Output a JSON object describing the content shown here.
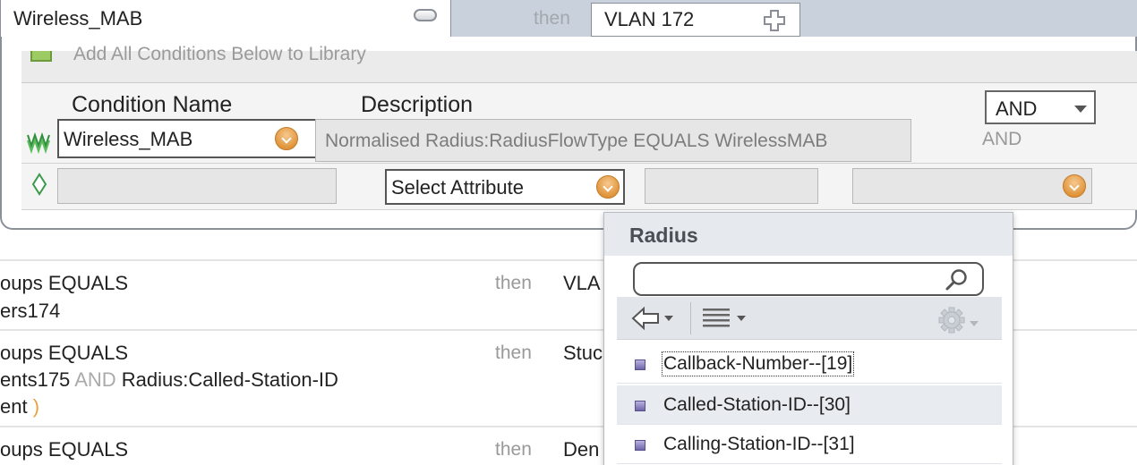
{
  "header": {
    "rule_name": "Wireless_MAB",
    "then": "then",
    "result": "VLAN 172"
  },
  "library": {
    "label": "Add All Conditions Below to Library"
  },
  "conditions": {
    "col_name": "Condition Name",
    "col_desc": "Description",
    "operator_select": "AND",
    "operator_label": "AND",
    "row1": {
      "name": "Wireless_MAB",
      "description": "Normalised Radius:RadiusFlowType EQUALS WirelessMAB"
    },
    "row2": {
      "attribute_select": "Select Attribute"
    }
  },
  "rules": [
    {
      "line1": "oups EQUALS",
      "line2": "ers174",
      "then": "then",
      "result": "VLA"
    },
    {
      "line1": "oups EQUALS",
      "line2": "ents175",
      "and": "AND",
      "line2b": "Radius:Called-Station-ID",
      "line3": "ent",
      "paren": ")",
      "then": "then",
      "result": "Stuc"
    },
    {
      "line1": "oups EQUALS",
      "then": "then",
      "result": "Den"
    }
  ],
  "dropdown": {
    "title": "Radius",
    "search_value": "",
    "items": [
      {
        "label": "Callback-Number--[19]"
      },
      {
        "label": "Called-Station-ID--[30]"
      },
      {
        "label": "Calling-Station-ID--[31]"
      }
    ]
  }
}
